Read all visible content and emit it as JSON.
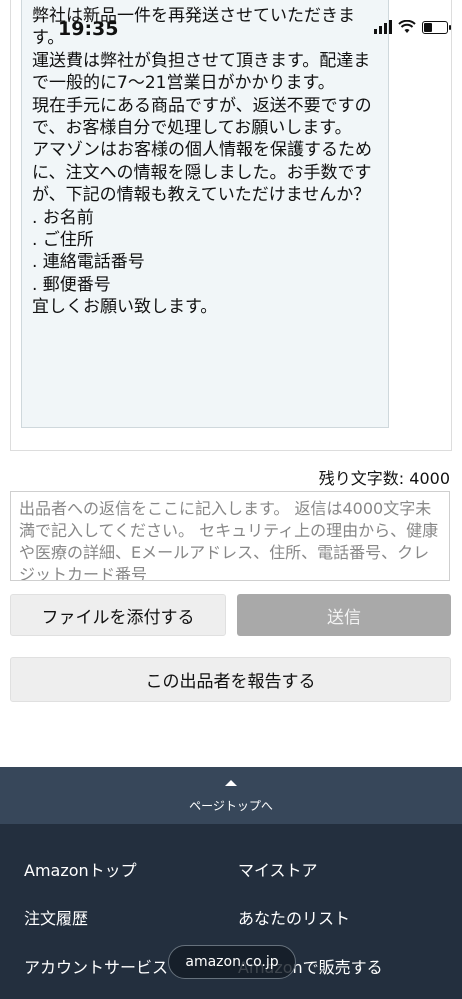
{
  "status_bar": {
    "time": "19:35"
  },
  "message": {
    "lines": [
      "弊社は新品一件を再発送させていただきます。",
      "運送費は弊社が負担させて頂きます。配達まで一般的に7〜21営業日がかかります。",
      "現在手元にある商品ですが、返送不要ですので、お客様自分で処理してお願いします。",
      "アマゾンはお客様の個人情報を保護するために、注文への情報を隠しました。お手数ですが、下記の情報も教えていただけませんか？",
      ". お名前",
      ". ご住所",
      ". 連絡電話番号",
      ". 郵便番号",
      "宜しくお願い致します。"
    ]
  },
  "reply": {
    "counter": "残り文字数: 4000",
    "placeholder": "出品者への返信をここに記入します。 返信は4000文字未満で記入してください。 セキュリティ上の理由から、健康や医療の詳細、Eメールアドレス、住所、電話番号、クレジットカード番号"
  },
  "buttons": {
    "attach": "ファイルを添付する",
    "send": "送信",
    "report": "この出品者を報告する"
  },
  "back_to_top": {
    "label": "ページトップへ"
  },
  "footer": {
    "links": [
      "Amazonトップ",
      "マイストア",
      "注文履歴",
      "あなたのリスト",
      "アカウントサービス",
      "Amazonで販売する"
    ]
  },
  "url_pill": {
    "domain": "amazon.co.jp"
  },
  "colors": {
    "footer_bg": "#232f3e",
    "backtop_bg": "#37475a",
    "send_disabled": "#a9a9a9"
  }
}
